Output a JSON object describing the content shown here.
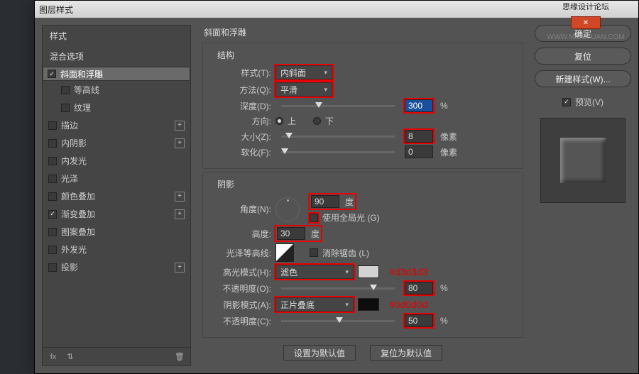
{
  "window": {
    "title": "图层样式",
    "forum": "思缘设计论坛",
    "watermark": "WWW.MISSYUAN.COM"
  },
  "left": {
    "styles_hdr": "样式",
    "blend_hdr": "混合选项",
    "items": [
      {
        "label": "斜面和浮雕",
        "checked": true,
        "selected": true,
        "plus": false,
        "sub": false
      },
      {
        "label": "等高线",
        "checked": false,
        "plus": false,
        "sub": true
      },
      {
        "label": "纹理",
        "checked": false,
        "plus": false,
        "sub": true
      },
      {
        "label": "描边",
        "checked": false,
        "plus": true,
        "sub": false
      },
      {
        "label": "内阴影",
        "checked": false,
        "plus": true,
        "sub": false
      },
      {
        "label": "内发光",
        "checked": false,
        "plus": false,
        "sub": false
      },
      {
        "label": "光泽",
        "checked": false,
        "plus": false,
        "sub": false
      },
      {
        "label": "颜色叠加",
        "checked": false,
        "plus": true,
        "sub": false
      },
      {
        "label": "渐变叠加",
        "checked": true,
        "plus": true,
        "sub": false
      },
      {
        "label": "图案叠加",
        "checked": false,
        "plus": false,
        "sub": false
      },
      {
        "label": "外发光",
        "checked": false,
        "plus": false,
        "sub": false
      },
      {
        "label": "投影",
        "checked": false,
        "plus": true,
        "sub": false
      }
    ]
  },
  "center": {
    "title": "斜面和浮雕",
    "struct": {
      "legend": "结构",
      "style_l": "样式(T):",
      "style_v": "内斜面",
      "tech_l": "方法(Q):",
      "tech_v": "平滑",
      "depth_l": "深度(D):",
      "depth_v": "300",
      "pct": "%",
      "dir_l": "方向:",
      "up": "上",
      "down": "下",
      "size_l": "大小(Z):",
      "size_v": "8",
      "px": "像素",
      "soft_l": "软化(F):",
      "soft_v": "0"
    },
    "shade": {
      "legend": "阴影",
      "angle_l": "角度(N):",
      "angle_v": "90",
      "deg": "度",
      "global_l": "使用全局光 (G)",
      "alt_l": "高度:",
      "alt_v": "30",
      "gloss_l": "光泽等高线:",
      "aa_l": "消除锯齿 (L)",
      "hmode_l": "高光模式(H):",
      "hmode_v": "滤色",
      "hcolor": "#d3d3d3",
      "hhex": "#d3d3d3",
      "hop_l": "不透明度(O):",
      "hop_v": "80",
      "smode_l": "阴影模式(A):",
      "smode_v": "正片叠底",
      "scolor": "#0d0d0d",
      "shex": "#0d0d0d",
      "sop_l": "不透明度(C):",
      "sop_v": "50"
    },
    "defaults": {
      "set": "设置为默认值",
      "reset": "复位为默认值"
    }
  },
  "right": {
    "ok": "确定",
    "cancel": "复位",
    "newstyle": "新建样式(W)...",
    "preview": "预览(V)"
  }
}
